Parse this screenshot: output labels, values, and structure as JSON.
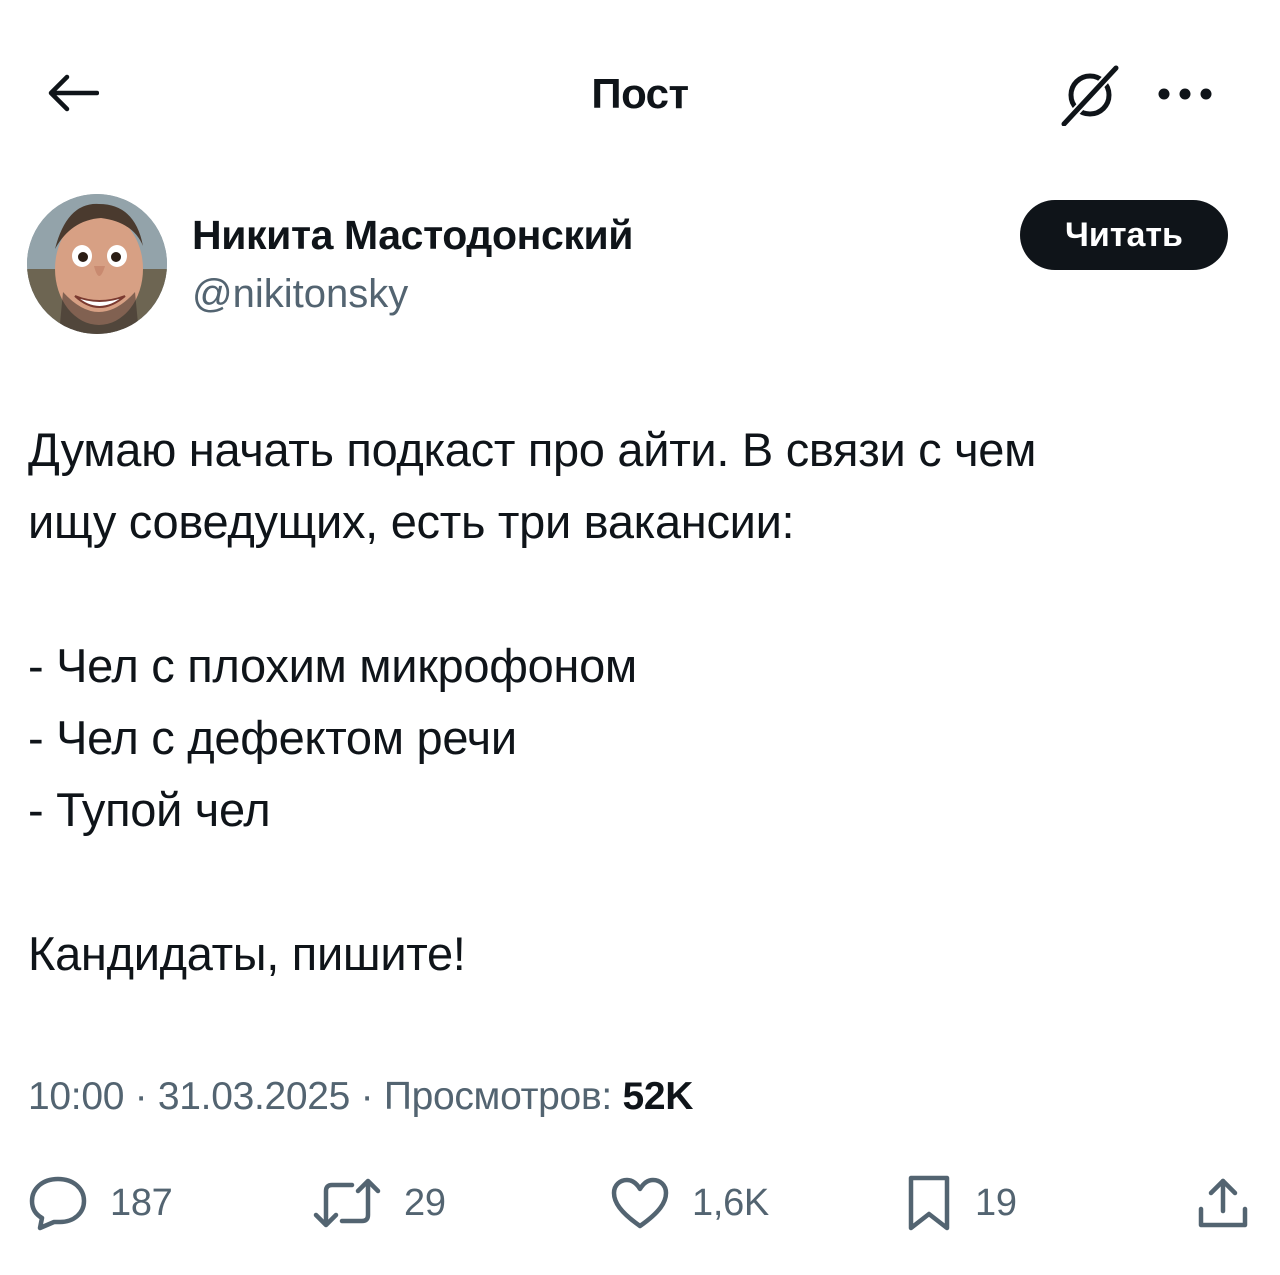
{
  "header": {
    "title": "Пост"
  },
  "author": {
    "name": "Никита Мастодонский",
    "handle": "@nikitonsky",
    "follow_label": "Читать"
  },
  "post": {
    "lines": [
      "Думаю начать подкаст про айти. В связи с чем",
      "ищу соведущих, есть три вакансии:",
      "",
      "- Чел с плохим микрофоном",
      "- Чел с дефектом речи",
      "- Тупой чел",
      "",
      "Кандидаты, пишите!"
    ]
  },
  "meta": {
    "time": "10:00",
    "separator": " · ",
    "date": "31.03.2025",
    "views_label": "Просмотров:",
    "views_count": "52K"
  },
  "actions": {
    "replies": "187",
    "reposts": "29",
    "likes": "1,6K",
    "bookmarks": "19"
  },
  "icons": {
    "back": "arrow-left-icon",
    "grok": "grok-icon",
    "more": "more-dots-icon",
    "reply": "reply-icon",
    "repost": "repost-icon",
    "like": "heart-icon",
    "bookmark": "bookmark-icon",
    "share": "share-icon"
  },
  "colors": {
    "text": "#0f1419",
    "secondary": "#536471",
    "button_bg": "#0f1419",
    "button_text": "#ffffff"
  }
}
